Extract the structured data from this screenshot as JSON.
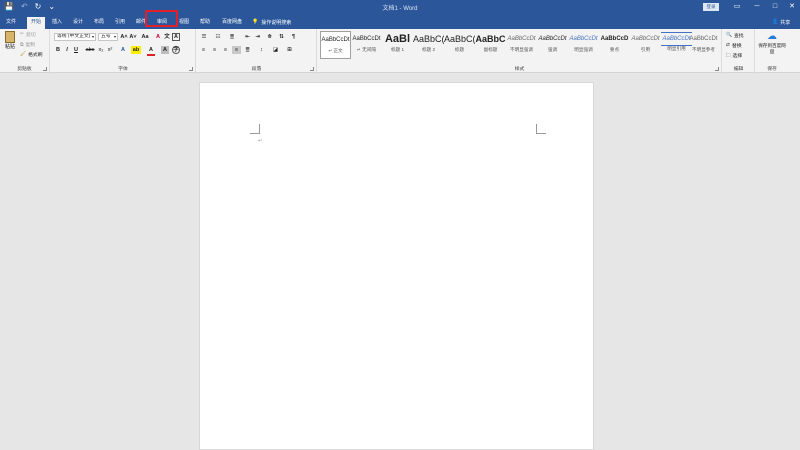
{
  "window": {
    "title": "文档1 - Word",
    "login_label": "登录",
    "share_label": "共享",
    "qat": [
      "💾",
      "↶",
      "↻",
      "⌄"
    ],
    "controls": [
      "▭",
      "─",
      "□",
      "✕"
    ]
  },
  "tabs": [
    "文件",
    "开始",
    "插入",
    "设计",
    "布局",
    "引用",
    "邮件",
    "审阅",
    "视图",
    "帮助",
    "百度网盘"
  ],
  "active_tab": "开始",
  "highlighted_tab": "审阅",
  "tell_me": "操作说明搜索",
  "clipboard": {
    "paste": "粘贴",
    "cut": "剪切",
    "copy": "复制",
    "format_painter": "格式刷",
    "label": "剪贴板"
  },
  "font": {
    "font_name": "等线 (中文正文)",
    "font_size": "五号",
    "label": "字体",
    "grow": "A˄",
    "shrink": "A˅",
    "case": "Aa",
    "clear": "A",
    "phonetic": "文",
    "border_char": "A",
    "bold": "B",
    "italic": "I",
    "underline": "U",
    "strike": "abc",
    "sub": "x₂",
    "sup": "x²",
    "effects": "A",
    "highlight": "ab",
    "color": "A",
    "shade": "A",
    "enclose": "字"
  },
  "paragraph": {
    "label": "段落"
  },
  "styles": {
    "label": "样式",
    "items": [
      {
        "sample": "AaBbCcDt",
        "name": "↵ 正文"
      },
      {
        "sample": "AaBbCcDt",
        "name": "↵ 无间隔"
      },
      {
        "sample": "AaBl",
        "name": "标题 1"
      },
      {
        "sample": "AaBbC(",
        "name": "标题 2"
      },
      {
        "sample": "AaBbC(",
        "name": "标题"
      },
      {
        "sample": "AaBbC",
        "name": "副标题"
      },
      {
        "sample": "AaBbCcDt",
        "name": "不明显强调"
      },
      {
        "sample": "AaBbCcDt",
        "name": "强调"
      },
      {
        "sample": "AaBbCcDt",
        "name": "明显强调"
      },
      {
        "sample": "AaBbCcD",
        "name": "要点"
      },
      {
        "sample": "AaBbCcDt",
        "name": "引用"
      },
      {
        "sample": "AaBbCcDt",
        "name": "明显引用"
      },
      {
        "sample": "AaBbCcDt",
        "name": "不明显参考"
      }
    ]
  },
  "editing": {
    "find": "查找",
    "replace": "替换",
    "select": "选择",
    "label": "编辑"
  },
  "save": {
    "button": "保存到百度网盘",
    "label": "保存"
  },
  "colors": {
    "brand": "#2b579a",
    "highlight_border": "#e0202d"
  }
}
